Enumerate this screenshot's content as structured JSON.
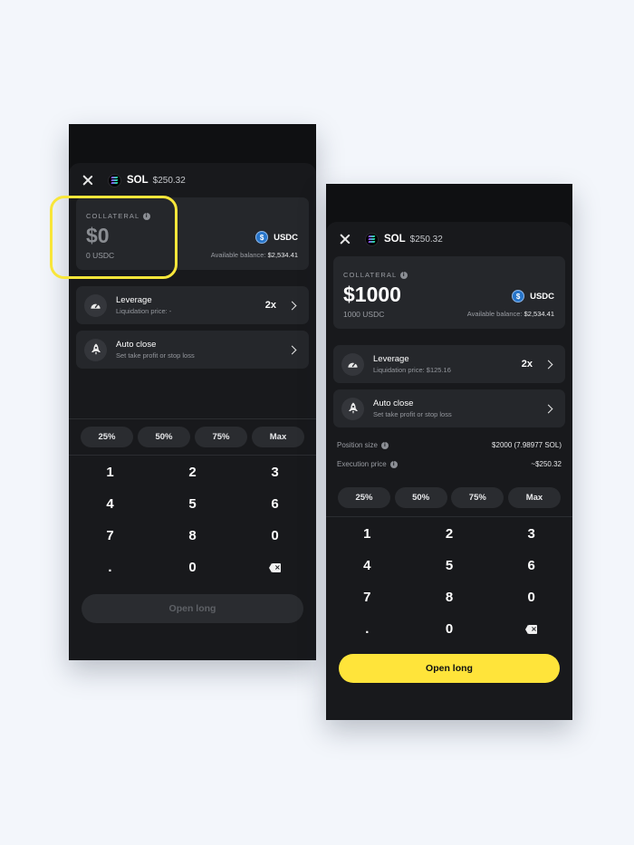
{
  "left": {
    "header": {
      "symbol": "SOL",
      "price": "$250.32"
    },
    "collateral": {
      "label": "COLLATERAL",
      "amount": "$0",
      "sub": "0 USDC",
      "token": "USDC",
      "available_label": "Available balance:",
      "available_value": "$2,534.41"
    },
    "leverage": {
      "title": "Leverage",
      "sub": "Liquidation price: -",
      "value": "2x"
    },
    "auto_close": {
      "title": "Auto close",
      "sub": "Set take profit or stop loss"
    },
    "quick": [
      "25%",
      "50%",
      "75%",
      "Max"
    ],
    "keys": [
      [
        "1",
        "2",
        "3"
      ],
      [
        "4",
        "5",
        "6"
      ],
      [
        "7",
        "8",
        "0"
      ],
      [
        ".",
        "0",
        ""
      ]
    ],
    "cta": "Open long"
  },
  "right": {
    "header": {
      "symbol": "SOL",
      "price": "$250.32"
    },
    "collateral": {
      "label": "COLLATERAL",
      "amount": "$1000",
      "sub": "1000 USDC",
      "token": "USDC",
      "available_label": "Available balance:",
      "available_value": "$2,534.41"
    },
    "leverage": {
      "title": "Leverage",
      "sub": "Liquidation price: $125.16",
      "value": "2x"
    },
    "auto_close": {
      "title": "Auto close",
      "sub": "Set take profit or stop loss"
    },
    "position_size": {
      "label": "Position size",
      "value": "$2000 (7.98977 SOL)"
    },
    "execution_price": {
      "label": "Execution price",
      "value": "~$250.32"
    },
    "quick": [
      "25%",
      "50%",
      "75%",
      "Max"
    ],
    "keys": [
      [
        "1",
        "2",
        "3"
      ],
      [
        "4",
        "5",
        "6"
      ],
      [
        "7",
        "8",
        "0"
      ],
      [
        ".",
        "0",
        ""
      ]
    ],
    "cta": "Open long"
  },
  "colors": {
    "accent": "#ffe43a",
    "background": "#18191c",
    "card": "#25272b"
  },
  "icons": [
    "close-icon",
    "sol-icon",
    "info-icon",
    "usdc-icon",
    "speedometer-icon",
    "rocket-icon",
    "chevron-right-icon",
    "backspace-icon"
  ]
}
